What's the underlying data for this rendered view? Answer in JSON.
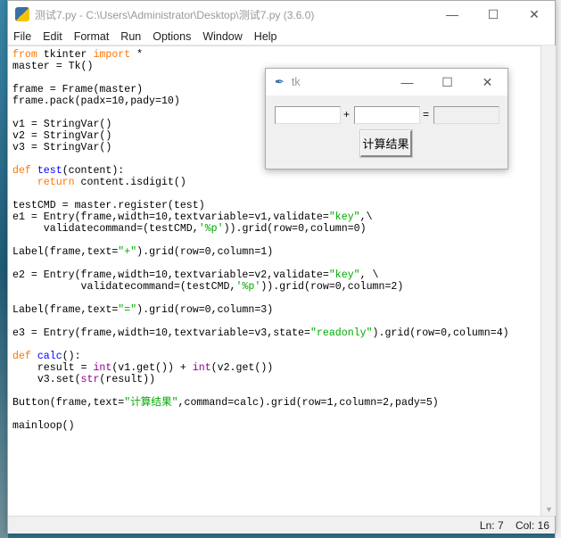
{
  "window": {
    "title": "测试7.py - C:\\Users\\Administrator\\Desktop\\测试7.py (3.6.0)",
    "minimize": "—",
    "maximize": "☐",
    "close": "✕"
  },
  "menu": [
    "File",
    "Edit",
    "Format",
    "Run",
    "Options",
    "Window",
    "Help"
  ],
  "code": [
    [
      [
        "from",
        "kw"
      ],
      " tkinter ",
      [
        "import",
        "kw"
      ],
      " *"
    ],
    [
      "master = Tk()"
    ],
    [
      ""
    ],
    [
      "frame = Frame(master)"
    ],
    [
      "frame.pack(padx=10,pady=10)"
    ],
    [
      ""
    ],
    [
      "v1 = StringVar()"
    ],
    [
      "v2 = StringVar()"
    ],
    [
      "v3 = StringVar()"
    ],
    [
      ""
    ],
    [
      [
        "def",
        "kw"
      ],
      " ",
      [
        "test",
        "fn"
      ],
      "(content):"
    ],
    [
      "    ",
      [
        "return",
        "kw"
      ],
      " content.isdigit()"
    ],
    [
      ""
    ],
    [
      "testCMD = master.register(test)"
    ],
    [
      "e1 = Entry(frame,width=10,textvariable=v1,validate=",
      [
        "\"key\"",
        "st"
      ],
      ",\\"
    ],
    [
      "     validatecommand=(testCMD,",
      [
        "'%p'",
        "st"
      ],
      ")).grid(row=0,column=0)"
    ],
    [
      ""
    ],
    [
      "Label(frame,text=",
      [
        "\"+\"",
        "st"
      ],
      ").grid(row=0,column=1)"
    ],
    [
      ""
    ],
    [
      "e2 = Entry(frame,width=10,textvariable=v2,validate=",
      [
        "\"key\"",
        "st"
      ],
      ", \\"
    ],
    [
      "           validatecommand=(testCMD,",
      [
        "'%p'",
        "st"
      ],
      ")).grid(row=0,column=2)"
    ],
    [
      ""
    ],
    [
      "Label(frame,text=",
      [
        "\"=\"",
        "st"
      ],
      ").grid(row=0,column=3)"
    ],
    [
      ""
    ],
    [
      "e3 = Entry(frame,width=10,textvariable=v3,state=",
      [
        "\"readonly\"",
        "st"
      ],
      ").grid(row=0,column=4)"
    ],
    [
      ""
    ],
    [
      [
        "def",
        "kw"
      ],
      " ",
      [
        "calc",
        "fn"
      ],
      "():"
    ],
    [
      "    result = ",
      [
        "int",
        "bi"
      ],
      "(v1.get()) + ",
      [
        "int",
        "bi"
      ],
      "(v2.get())"
    ],
    [
      "    v3.set(",
      [
        "str",
        "bi"
      ],
      "(result))"
    ],
    [
      ""
    ],
    [
      "Button(frame,text=",
      [
        "\"计算结果\"",
        "st"
      ],
      ",command=calc).grid(row=1,column=2,pady=5)"
    ],
    [
      ""
    ],
    [
      "mainloop()"
    ]
  ],
  "status": {
    "line": "Ln: 7",
    "col": "Col: 16"
  },
  "tk": {
    "title": "tk",
    "plus": "+",
    "equals": "=",
    "button": "计算结果",
    "entry1": "",
    "entry2": "",
    "entry3": "",
    "minimize": "—",
    "maximize": "☐",
    "close": "✕"
  }
}
